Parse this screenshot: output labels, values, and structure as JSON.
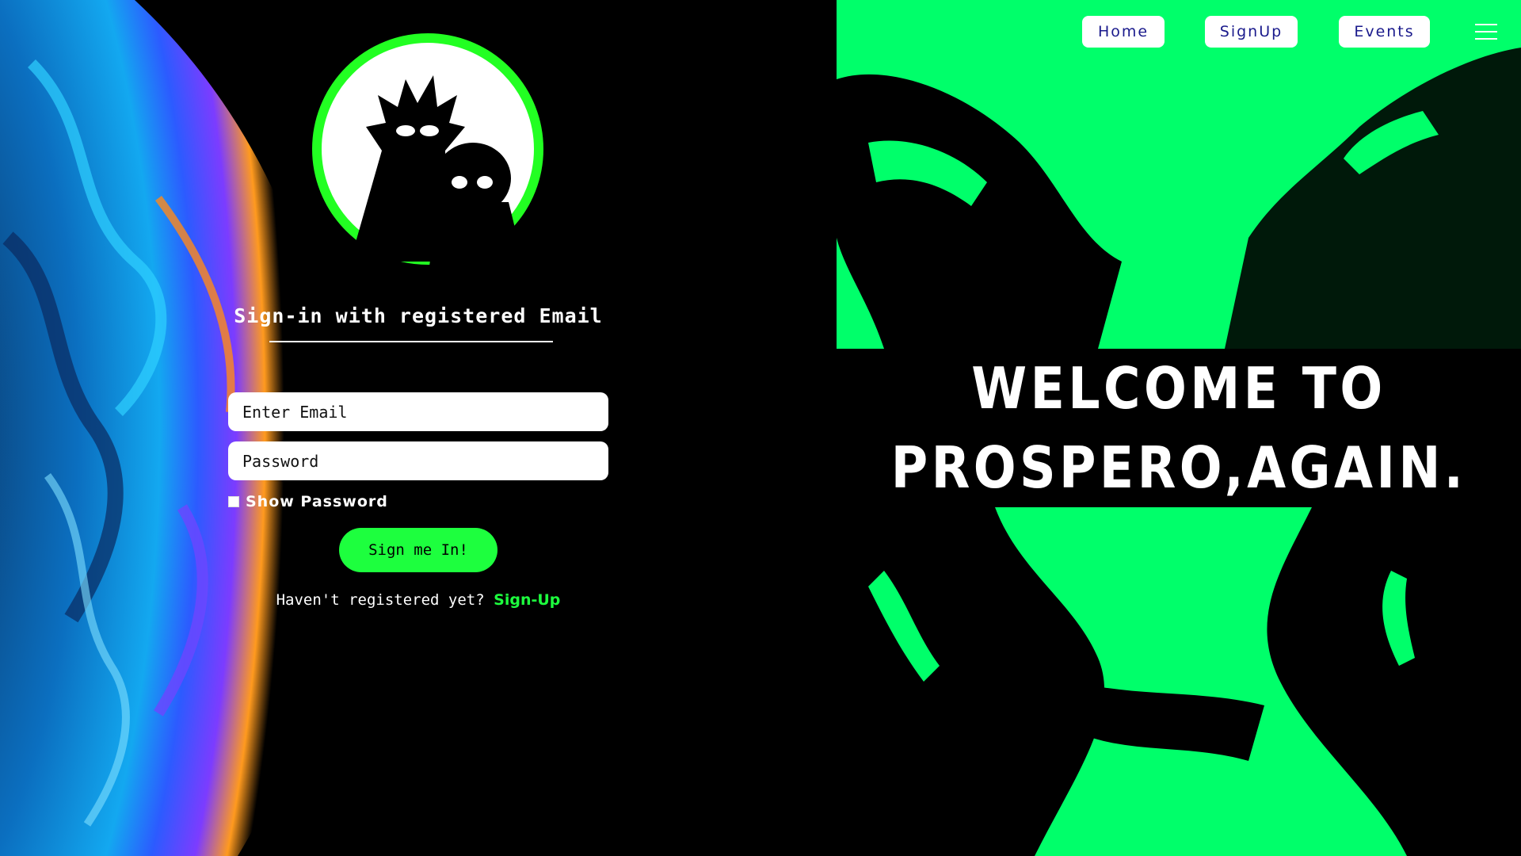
{
  "nav": {
    "home": "Home",
    "signup": "SignUp",
    "events": "Events",
    "menu_icon": "hamburger-icon"
  },
  "hero": {
    "line1": "WELCOME TO",
    "line2": "PROSPERO,AGAIN."
  },
  "signin": {
    "title": "Sign-in with registered Email",
    "email_placeholder": "Enter Email",
    "password_placeholder": "Password",
    "show_password": "Show Password",
    "submit": "Sign me In!",
    "register_prompt": "Haven't registered yet?",
    "register_link": "Sign-Up"
  },
  "colors": {
    "accent_green": "#1dff3e",
    "panel_green": "#00ff6a",
    "nav_text": "#1a1a8c",
    "background": "#000000"
  },
  "icons": {
    "logo": "rick-and-morty-silhouette-logo",
    "menu": "hamburger-icon"
  }
}
